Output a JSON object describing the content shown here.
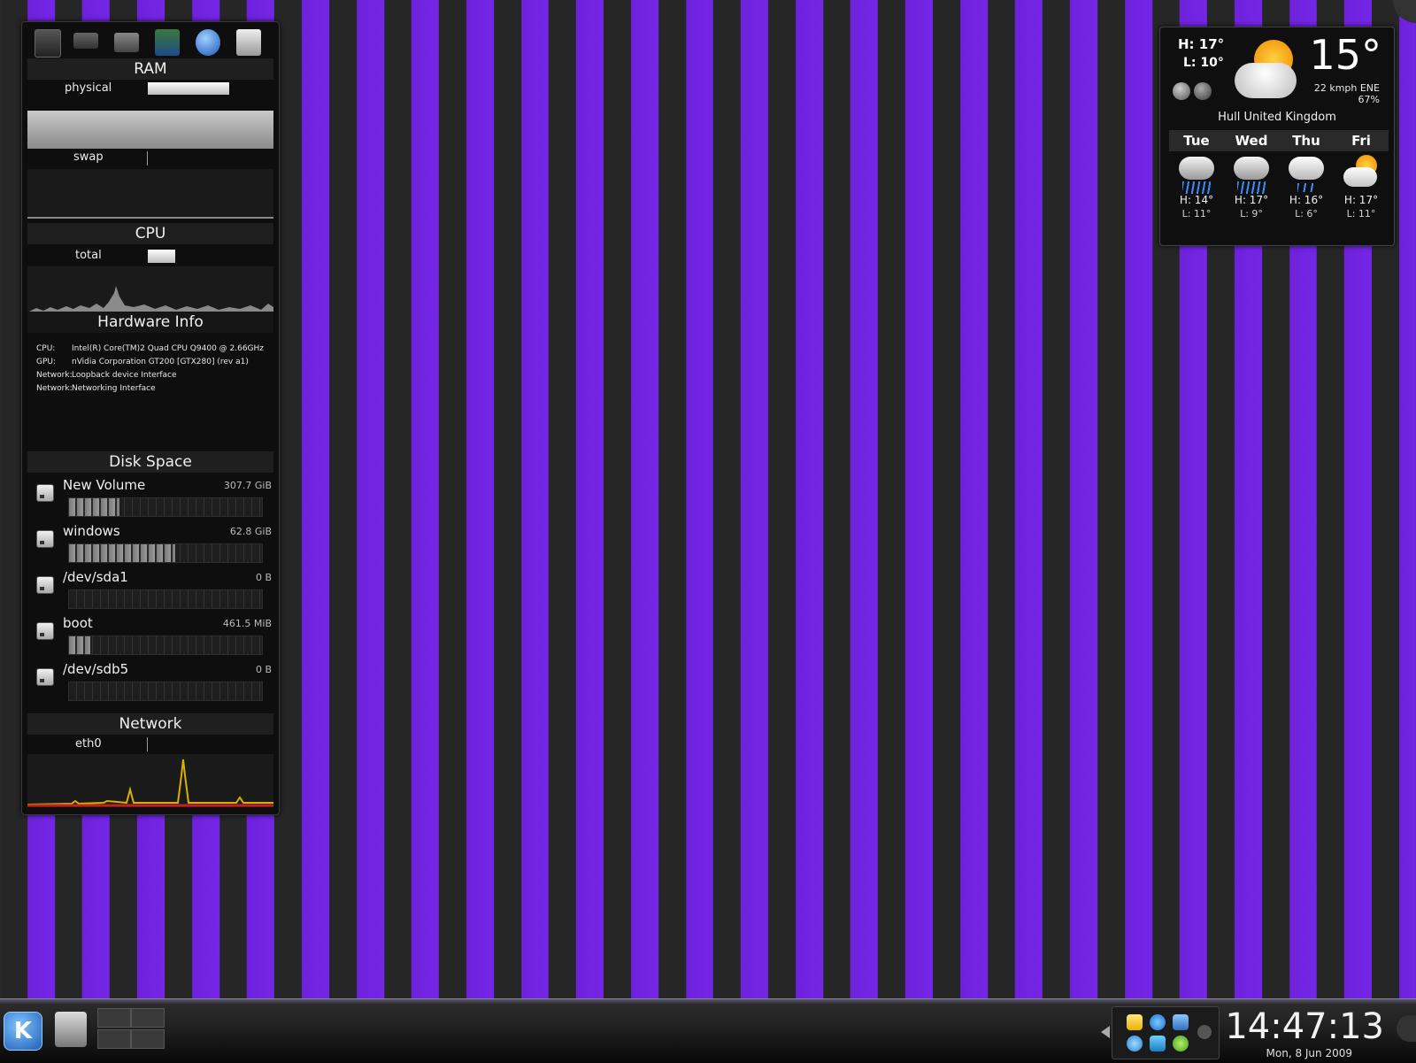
{
  "sysmon": {
    "toolbar_icons": [
      "cpu-chip-icon",
      "memory-module-icon",
      "hard-drive-icon",
      "motherboard-info-icon",
      "network-globe-icon",
      "disk-space-icon"
    ],
    "ram": {
      "title": "RAM",
      "physical_label": "physical",
      "physical_level": 0.88,
      "swap_label": "swap",
      "swap_level": 0.0
    },
    "cpu": {
      "title": "CPU",
      "total_label": "total",
      "total_level": 0.28
    },
    "hardware": {
      "title": "Hardware Info",
      "rows": [
        {
          "key": "CPU:",
          "value": "Intel(R) Core(TM)2 Quad CPU Q9400 @ 2.66GHz"
        },
        {
          "key": "GPU:",
          "value": "nVidia Corporation GT200 [GTX280] (rev a1)"
        },
        {
          "key": "Network:",
          "value": "Loopback device Interface"
        },
        {
          "key": "Network:",
          "value": "Networking Interface"
        }
      ]
    },
    "disks": {
      "title": "Disk Space",
      "items": [
        {
          "name": "New Volume",
          "size": "307.7 GiB",
          "usage": 0.26
        },
        {
          "name": "windows",
          "size": "62.8 GiB",
          "usage": 0.55
        },
        {
          "name": "/dev/sda1",
          "size": "0 B",
          "usage": 0.0
        },
        {
          "name": "boot",
          "size": "461.5 MiB",
          "usage": 0.11
        },
        {
          "name": "/dev/sdb5",
          "size": "0 B",
          "usage": 0.0
        }
      ]
    },
    "network": {
      "title": "Network",
      "iface_label": "eth0"
    }
  },
  "weather": {
    "high": "H: 17°",
    "low": "L: 10°",
    "temp": "15°",
    "wind": "22 kmph ENE",
    "humidity": "67%",
    "location": "Hull United Kingdom",
    "condition_icon": "partly-cloudy-sun-icon",
    "forecast": [
      {
        "day": "Tue",
        "high": "H: 14°",
        "low": "L: 11°",
        "icon": "rain-cloud-icon"
      },
      {
        "day": "Wed",
        "high": "H: 17°",
        "low": "L: 9°",
        "icon": "rain-cloud-icon"
      },
      {
        "day": "Thu",
        "high": "H: 16°",
        "low": "L: 6°",
        "icon": "light-rain-cloud-icon"
      },
      {
        "day": "Fri",
        "high": "H: 17°",
        "low": "L: 11°",
        "icon": "sun-cloud-icon"
      }
    ]
  },
  "taskbar": {
    "clock": "14:47:13",
    "date": "Mon, 8 Jun 2009"
  },
  "colors": {
    "stripe_purple": "#7426e6",
    "stripe_dark": "#262626"
  }
}
